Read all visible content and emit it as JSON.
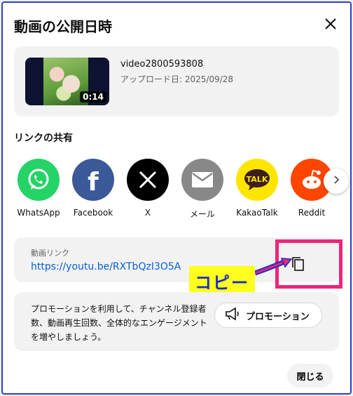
{
  "dialog": {
    "title": "動画の公開日時",
    "close_icon": "close-icon"
  },
  "video": {
    "title": "video2800593808",
    "upload_date": "アップロード日: 2025/09/28",
    "duration": "0:14"
  },
  "share": {
    "heading": "リンクの共有",
    "items": [
      {
        "label": "WhatsApp",
        "icon": "whatsapp-icon",
        "color": "#25d366"
      },
      {
        "label": "Facebook",
        "icon": "facebook-icon",
        "color": "#3b5998"
      },
      {
        "label": "X",
        "icon": "x-icon",
        "color": "#000000"
      },
      {
        "label": "メール",
        "icon": "mail-icon",
        "color": "#888888"
      },
      {
        "label": "KakaoTalk",
        "icon": "kakaotalk-icon",
        "color": "#fee500"
      },
      {
        "label": "Reddit",
        "icon": "reddit-icon",
        "color": "#ff4500"
      }
    ],
    "next_icon": "chevron-right-icon"
  },
  "link": {
    "label": "動画リンク",
    "url": "https://youtu.be/RXTbQzI3O5A",
    "copy_icon": "copy-icon"
  },
  "annotation": {
    "callout_text": "コピー",
    "highlight_color": "#ee2479",
    "callout_bg": "#ffff1e",
    "callout_text_color": "#1a2ec8"
  },
  "promotion": {
    "text": "プロモーションを利用して、チャンネル登録者数、動画再生回数、全体的なエンゲージメントを増やしましょう。",
    "button_label": "プロモーション",
    "button_icon": "megaphone-icon"
  },
  "footer": {
    "close_label": "閉じる"
  }
}
